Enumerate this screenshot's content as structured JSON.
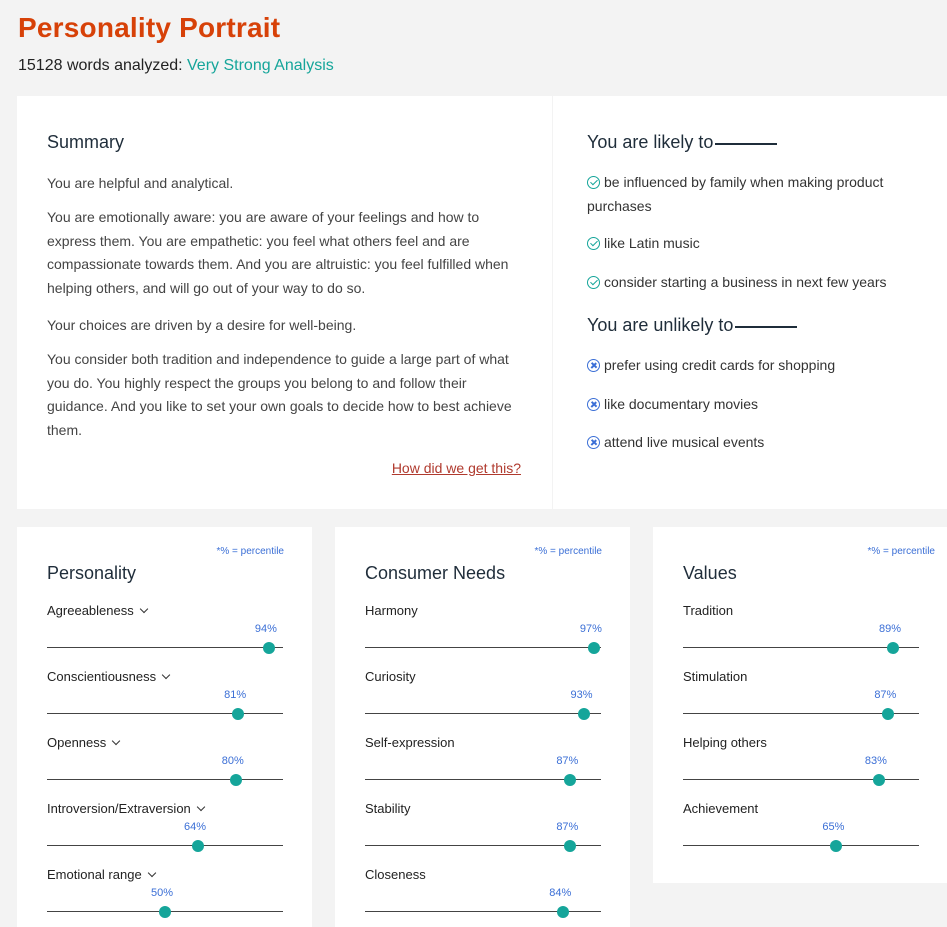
{
  "header": {
    "title": "Personality Portrait",
    "words_analyzed": "15128 words analyzed:",
    "strength": "Very Strong Analysis"
  },
  "summary": {
    "heading": "Summary",
    "paragraphs": [
      "You are helpful and analytical.",
      "You are emotionally aware: you are aware of your feelings and how to express them. You are empathetic: you feel what others feel and are compassionate towards them. And you are altruistic: you feel fulfilled when helping others, and will go out of your way to do so.",
      "Your choices are driven by a desire for well-being.",
      "You consider both tradition and independence to guide a large part of what you do. You highly respect the groups you belong to and follow their guidance. And you like to set your own goals to decide how to best achieve them."
    ],
    "link_label": "How did we get this?"
  },
  "likely": {
    "heading": "You are likely to",
    "items": [
      "be influenced by family when making product purchases",
      "like Latin music",
      "consider starting a business in next few years"
    ]
  },
  "unlikely": {
    "heading": "You are unlikely to",
    "items": [
      "prefer using credit cards for shopping",
      "like documentary movies",
      "attend live musical events"
    ]
  },
  "percentile_note": "*% = percentile",
  "personality": {
    "heading": "Personality",
    "items": [
      {
        "label": "Agreeableness",
        "value": 94,
        "pct": "94%"
      },
      {
        "label": "Conscientiousness",
        "value": 81,
        "pct": "81%"
      },
      {
        "label": "Openness",
        "value": 80,
        "pct": "80%"
      },
      {
        "label": "Introversion/Extraversion",
        "value": 64,
        "pct": "64%"
      },
      {
        "label": "Emotional range",
        "value": 50,
        "pct": "50%"
      }
    ]
  },
  "consumer_needs": {
    "heading": "Consumer Needs",
    "items": [
      {
        "label": "Harmony",
        "value": 97,
        "pct": "97%"
      },
      {
        "label": "Curiosity",
        "value": 93,
        "pct": "93%"
      },
      {
        "label": "Self-expression",
        "value": 87,
        "pct": "87%"
      },
      {
        "label": "Stability",
        "value": 87,
        "pct": "87%"
      },
      {
        "label": "Closeness",
        "value": 84,
        "pct": "84%"
      }
    ]
  },
  "values": {
    "heading": "Values",
    "items": [
      {
        "label": "Tradition",
        "value": 89,
        "pct": "89%"
      },
      {
        "label": "Stimulation",
        "value": 87,
        "pct": "87%"
      },
      {
        "label": "Helping others",
        "value": 83,
        "pct": "83%"
      },
      {
        "label": "Achievement",
        "value": 65,
        "pct": "65%"
      }
    ]
  },
  "colors": {
    "title": "#d74108",
    "accent_teal": "#15a59a",
    "percent_blue": "#3b6fd6",
    "link": "#b03a2e"
  },
  "icons": {
    "likely": "check-circle-icon",
    "unlikely": "x-circle-icon",
    "expand": "chevron-down-icon"
  }
}
